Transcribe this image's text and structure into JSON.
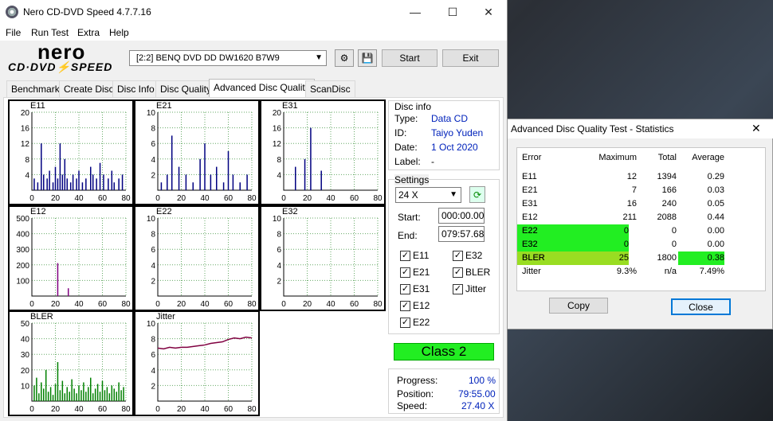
{
  "app": {
    "title": "Nero CD-DVD Speed 4.7.7.16",
    "minimize": "—",
    "maximize": "☐",
    "close": "✕"
  },
  "menu": [
    "File",
    "Run Test",
    "Extra",
    "Help"
  ],
  "logo": {
    "brand": "nero",
    "product": "CD·DVD⚡SPEED"
  },
  "toolbar": {
    "drive": "[2:2]   BENQ DVD DD DW1620 B7W9",
    "start_label": "Start",
    "exit_label": "Exit"
  },
  "tabs": [
    "Benchmark",
    "Create Disc",
    "Disc Info",
    "Disc Quality",
    "Advanced Disc Quality",
    "ScanDisc"
  ],
  "active_tab": "Advanced Disc Quality",
  "disc_info": {
    "heading": "Disc info",
    "type_label": "Type:",
    "type": "Data CD",
    "id_label": "ID:",
    "id": "Taiyo Yuden",
    "date_label": "Date:",
    "date": "1 Oct 2020",
    "label_label": "Label:",
    "label": "-"
  },
  "settings": {
    "heading": "Settings",
    "speed": "24 X",
    "start_label": "Start:",
    "start": "000:00.00",
    "end_label": "End:",
    "end": "079:57.68",
    "checks": [
      {
        "label": "E11",
        "checked": true
      },
      {
        "label": "E32",
        "checked": true
      },
      {
        "label": "E21",
        "checked": true
      },
      {
        "label": "BLER",
        "checked": true
      },
      {
        "label": "E31",
        "checked": true
      },
      {
        "label": "Jitter",
        "checked": true
      },
      {
        "label": "E12",
        "checked": true
      },
      {
        "label": "E22",
        "checked": true
      }
    ]
  },
  "class_label": "Class 2",
  "progress": {
    "progress_label": "Progress:",
    "progress": "100 %",
    "position_label": "Position:",
    "position": "79:55.00",
    "speed_label": "Speed:",
    "speed": "27.40 X"
  },
  "charts": [
    {
      "name": "E11",
      "yticks": [
        "20",
        "16",
        "12",
        "8",
        "4"
      ],
      "ymax": 20,
      "xticks": [
        "0",
        "20",
        "40",
        "60",
        "80"
      ],
      "color": "#000080"
    },
    {
      "name": "E21",
      "yticks": [
        "10",
        "8",
        "6",
        "4",
        "2"
      ],
      "ymax": 10,
      "xticks": [
        "0",
        "20",
        "40",
        "60",
        "80"
      ],
      "color": "#000080"
    },
    {
      "name": "E31",
      "yticks": [
        "20",
        "16",
        "12",
        "8",
        "4"
      ],
      "ymax": 20,
      "xticks": [
        "0",
        "20",
        "40",
        "60",
        "80"
      ],
      "color": "#000080"
    },
    {
      "name": "E12",
      "yticks": [
        "500",
        "400",
        "300",
        "200",
        "100"
      ],
      "ymax": 500,
      "xticks": [
        "0",
        "20",
        "40",
        "60",
        "80"
      ],
      "color": "#800080"
    },
    {
      "name": "E22",
      "yticks": [
        "10",
        "8",
        "6",
        "4",
        "2"
      ],
      "ymax": 10,
      "xticks": [
        "0",
        "20",
        "40",
        "60",
        "80"
      ],
      "color": "#000080"
    },
    {
      "name": "E32",
      "yticks": [
        "10",
        "8",
        "6",
        "4",
        "2"
      ],
      "ymax": 10,
      "xticks": [
        "0",
        "20",
        "40",
        "60",
        "80"
      ],
      "color": "#000080"
    },
    {
      "name": "BLER",
      "yticks": [
        "50",
        "40",
        "30",
        "20",
        "10"
      ],
      "ymax": 50,
      "xticks": [
        "0",
        "20",
        "40",
        "60",
        "80"
      ],
      "color": "#008000"
    },
    {
      "name": "Jitter",
      "yticks": [
        "10",
        "8",
        "6",
        "4",
        "2"
      ],
      "ymax": 10,
      "xticks": [
        "0",
        "20",
        "40",
        "60",
        "80"
      ],
      "color": "#800040"
    }
  ],
  "chart_data": [
    {
      "type": "bar",
      "title": "E11",
      "x": [
        2,
        5,
        8,
        10,
        13,
        15,
        18,
        20,
        22,
        24,
        26,
        28,
        30,
        33,
        35,
        38,
        40,
        43,
        46,
        50,
        52,
        55,
        58,
        61,
        65,
        68,
        70,
        74,
        77
      ],
      "values": [
        3,
        2,
        12,
        4,
        3,
        5,
        2,
        6,
        3,
        12,
        4,
        8,
        3,
        2,
        4,
        3,
        5,
        2,
        3,
        6,
        4,
        3,
        7,
        4,
        3,
        5,
        2,
        3,
        4
      ],
      "ylim": [
        0,
        20
      ],
      "xlim": [
        0,
        80
      ]
    },
    {
      "type": "bar",
      "title": "E21",
      "x": [
        3,
        8,
        12,
        18,
        24,
        30,
        36,
        40,
        45,
        50,
        56,
        60,
        64,
        70,
        76
      ],
      "values": [
        1,
        2,
        7,
        3,
        2,
        1,
        4,
        6,
        2,
        3,
        1,
        5,
        2,
        1,
        2
      ],
      "ylim": [
        0,
        10
      ],
      "xlim": [
        0,
        80
      ]
    },
    {
      "type": "bar",
      "title": "E31",
      "x": [
        10,
        18,
        23,
        32
      ],
      "values": [
        6,
        8,
        16,
        5
      ],
      "ylim": [
        0,
        20
      ],
      "xlim": [
        0,
        80
      ]
    },
    {
      "type": "bar",
      "title": "E12",
      "x": [
        22,
        31
      ],
      "values": [
        211,
        50
      ],
      "ylim": [
        0,
        500
      ],
      "xlim": [
        0,
        80
      ]
    },
    {
      "type": "bar",
      "title": "E22",
      "x": [],
      "values": [],
      "ylim": [
        0,
        10
      ],
      "xlim": [
        0,
        80
      ]
    },
    {
      "type": "bar",
      "title": "E32",
      "x": [],
      "values": [],
      "ylim": [
        0,
        10
      ],
      "xlim": [
        0,
        80
      ]
    },
    {
      "type": "bar",
      "title": "BLER",
      "x": [
        2,
        4,
        6,
        8,
        10,
        12,
        14,
        16,
        18,
        20,
        22,
        24,
        26,
        28,
        30,
        32,
        34,
        36,
        38,
        40,
        42,
        44,
        46,
        48,
        50,
        52,
        54,
        56,
        58,
        60,
        62,
        64,
        66,
        68,
        70,
        72,
        74,
        76,
        78
      ],
      "values": [
        10,
        15,
        5,
        12,
        8,
        20,
        6,
        9,
        4,
        11,
        25,
        7,
        13,
        5,
        9,
        6,
        14,
        8,
        5,
        10,
        7,
        12,
        6,
        9,
        15,
        5,
        8,
        11,
        6,
        13,
        7,
        9,
        5,
        10,
        8,
        6,
        12,
        7,
        9
      ],
      "ylim": [
        0,
        50
      ],
      "xlim": [
        0,
        80
      ]
    },
    {
      "type": "line",
      "title": "Jitter",
      "x": [
        0,
        5,
        10,
        15,
        20,
        25,
        30,
        35,
        40,
        45,
        50,
        55,
        60,
        65,
        70,
        75,
        80
      ],
      "values": [
        6.8,
        6.7,
        6.9,
        6.8,
        6.9,
        6.9,
        7.0,
        7.1,
        7.2,
        7.4,
        7.5,
        7.6,
        7.9,
        8.1,
        8.0,
        8.2,
        8.1
      ],
      "ylim": [
        0,
        10
      ],
      "xlim": [
        0,
        80
      ]
    }
  ],
  "stats": {
    "title": "Advanced Disc Quality Test - Statistics",
    "close": "✕",
    "headers": [
      "Error",
      "Maximum",
      "Total",
      "Average"
    ],
    "rows": [
      {
        "error": "E11",
        "max": "12",
        "total": "1394",
        "avg": "0.29",
        "hl_max": "",
        "hl_avg": ""
      },
      {
        "error": "E21",
        "max": "7",
        "total": "166",
        "avg": "0.03",
        "hl_max": "",
        "hl_avg": ""
      },
      {
        "error": "E31",
        "max": "16",
        "total": "240",
        "avg": "0.05",
        "hl_max": "",
        "hl_avg": ""
      },
      {
        "error": "E12",
        "max": "211",
        "total": "2088",
        "avg": "0.44",
        "hl_max": "",
        "hl_avg": ""
      },
      {
        "error": "E22",
        "max": "0",
        "total": "0",
        "avg": "0.00",
        "hl_max": "green",
        "hl_avg": ""
      },
      {
        "error": "E32",
        "max": "0",
        "total": "0",
        "avg": "0.00",
        "hl_max": "green",
        "hl_avg": ""
      },
      {
        "error": "BLER",
        "max": "25",
        "total": "1800",
        "avg": "0.38",
        "hl_max": "yellow",
        "hl_avg": "green"
      },
      {
        "error": "Jitter",
        "max": "9.3%",
        "total": "n/a",
        "avg": "7.49%",
        "hl_max": "",
        "hl_avg": ""
      }
    ],
    "copy_label": "Copy",
    "close_label": "Close"
  },
  "colors": {
    "highlight_green": "#22ee22",
    "highlight_yellow": "#99dd22",
    "value_blue": "#0022bb"
  }
}
